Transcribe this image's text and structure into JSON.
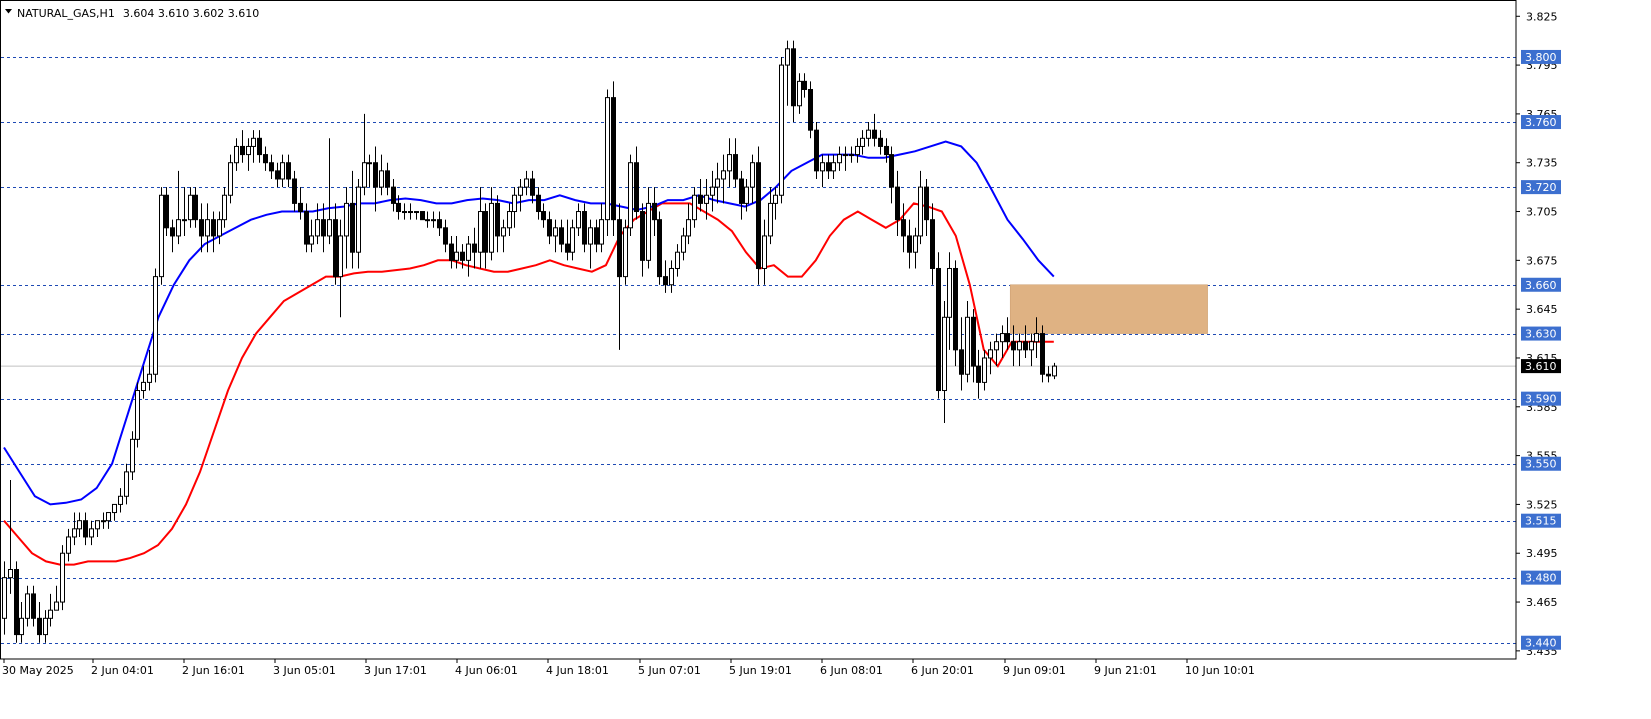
{
  "header": {
    "symbol": "NATURAL_GAS,H1",
    "ohlc": "3.604 3.610 3.602 3.610"
  },
  "colors": {
    "background": "#ffffff",
    "frame": "#000000",
    "level_line": "#1e4ab4",
    "level_tag": "#3c6fcf",
    "ema_fast": "#ff0000",
    "ema_slow": "#0000ff",
    "zone_fill": "#dfb283",
    "current_price_tag": "#000000",
    "bull_candle_body": "#ffffff",
    "bear_candle_body": "#000000"
  },
  "chart_data": {
    "type": "candlestick",
    "instrument": "NATURAL_GAS",
    "timeframe": "H1",
    "ylim": [
      3.43,
      3.835
    ],
    "y_ticks": [
      "3.825",
      "3.795",
      "3.765",
      "3.735",
      "3.705",
      "3.675",
      "3.645",
      "3.615",
      "3.585",
      "3.555",
      "3.525",
      "3.495",
      "3.465",
      "3.435"
    ],
    "x_ticks": [
      "30 May 2025",
      "2 Jun 04:01",
      "2 Jun 16:01",
      "3 Jun 05:01",
      "3 Jun 17:01",
      "4 Jun 06:01",
      "4 Jun 18:01",
      "5 Jun 07:01",
      "5 Jun 19:01",
      "6 Jun 08:01",
      "6 Jun 20:01",
      "9 Jun 09:01",
      "9 Jun 21:01",
      "10 Jun 10:01"
    ],
    "levels": [
      3.8,
      3.76,
      3.72,
      3.66,
      3.63,
      3.59,
      3.55,
      3.515,
      3.48,
      3.44
    ],
    "level_labels": [
      "3.800",
      "3.760",
      "3.720",
      "3.660",
      "3.630",
      "3.590",
      "3.550",
      "3.515",
      "3.480",
      "3.440"
    ],
    "current_price": 3.61,
    "current_price_label": "3.610",
    "zone": {
      "top": 3.66,
      "bottom": 3.63,
      "from_bar": 174,
      "to_bar": 207
    },
    "candles": [
      [
        3.455,
        3.49,
        3.445,
        3.48
      ],
      [
        3.48,
        3.54,
        3.47,
        3.485
      ],
      [
        3.485,
        3.49,
        3.44,
        3.445
      ],
      [
        3.445,
        3.465,
        3.44,
        3.455
      ],
      [
        3.455,
        3.475,
        3.45,
        3.47
      ],
      [
        3.47,
        3.475,
        3.45,
        3.455
      ],
      [
        3.455,
        3.465,
        3.44,
        3.445
      ],
      [
        3.445,
        3.46,
        3.44,
        3.455
      ],
      [
        3.455,
        3.47,
        3.45,
        3.46
      ],
      [
        3.46,
        3.475,
        3.46,
        3.465
      ],
      [
        3.465,
        3.5,
        3.46,
        3.495
      ],
      [
        3.495,
        3.51,
        3.49,
        3.505
      ],
      [
        3.505,
        3.52,
        3.5,
        3.51
      ],
      [
        3.51,
        3.52,
        3.505,
        3.515
      ],
      [
        3.515,
        3.52,
        3.5,
        3.505
      ],
      [
        3.505,
        3.515,
        3.5,
        3.51
      ],
      [
        3.51,
        3.515,
        3.505,
        3.515
      ],
      [
        3.515,
        3.52,
        3.51,
        3.515
      ],
      [
        3.515,
        3.52,
        3.51,
        3.52
      ],
      [
        3.52,
        3.525,
        3.515,
        3.525
      ],
      [
        3.525,
        3.535,
        3.52,
        3.53
      ],
      [
        3.53,
        3.55,
        3.525,
        3.545
      ],
      [
        3.545,
        3.57,
        3.54,
        3.565
      ],
      [
        3.565,
        3.6,
        3.56,
        3.595
      ],
      [
        3.595,
        3.61,
        3.59,
        3.6
      ],
      [
        3.6,
        3.62,
        3.595,
        3.605
      ],
      [
        3.605,
        3.67,
        3.6,
        3.665
      ],
      [
        3.665,
        3.72,
        3.66,
        3.715
      ],
      [
        3.715,
        3.72,
        3.69,
        3.695
      ],
      [
        3.695,
        3.7,
        3.68,
        3.69
      ],
      [
        3.69,
        3.73,
        3.685,
        3.7
      ],
      [
        3.7,
        3.72,
        3.69,
        3.7
      ],
      [
        3.7,
        3.72,
        3.695,
        3.715
      ],
      [
        3.715,
        3.72,
        3.695,
        3.7
      ],
      [
        3.7,
        3.71,
        3.68,
        3.69
      ],
      [
        3.69,
        3.71,
        3.68,
        3.7
      ],
      [
        3.7,
        3.705,
        3.68,
        3.69
      ],
      [
        3.69,
        3.705,
        3.685,
        3.7
      ],
      [
        3.7,
        3.72,
        3.695,
        3.715
      ],
      [
        3.715,
        3.74,
        3.71,
        3.735
      ],
      [
        3.735,
        3.75,
        3.73,
        3.745
      ],
      [
        3.745,
        3.755,
        3.735,
        3.74
      ],
      [
        3.74,
        3.75,
        3.73,
        3.745
      ],
      [
        3.745,
        3.755,
        3.735,
        3.75
      ],
      [
        3.75,
        3.755,
        3.735,
        3.74
      ],
      [
        3.74,
        3.745,
        3.73,
        3.735
      ],
      [
        3.735,
        3.74,
        3.725,
        3.73
      ],
      [
        3.73,
        3.735,
        3.72,
        3.725
      ],
      [
        3.725,
        3.74,
        3.72,
        3.735
      ],
      [
        3.735,
        3.74,
        3.72,
        3.725
      ],
      [
        3.725,
        3.73,
        3.705,
        3.71
      ],
      [
        3.71,
        3.72,
        3.7,
        3.705
      ],
      [
        3.705,
        3.71,
        3.68,
        3.685
      ],
      [
        3.685,
        3.7,
        3.68,
        3.69
      ],
      [
        3.69,
        3.71,
        3.685,
        3.7
      ],
      [
        3.7,
        3.71,
        3.68,
        3.69
      ],
      [
        3.69,
        3.75,
        3.685,
        3.7
      ],
      [
        3.7,
        3.71,
        3.66,
        3.665
      ],
      [
        3.665,
        3.7,
        3.64,
        3.69
      ],
      [
        3.69,
        3.72,
        3.67,
        3.71
      ],
      [
        3.71,
        3.73,
        3.67,
        3.68
      ],
      [
        3.68,
        3.725,
        3.67,
        3.72
      ],
      [
        3.72,
        3.765,
        3.715,
        3.735
      ],
      [
        3.735,
        3.74,
        3.72,
        3.735
      ],
      [
        3.735,
        3.745,
        3.705,
        3.72
      ],
      [
        3.72,
        3.74,
        3.715,
        3.73
      ],
      [
        3.73,
        3.735,
        3.715,
        3.72
      ],
      [
        3.72,
        3.725,
        3.705,
        3.71
      ],
      [
        3.71,
        3.715,
        3.7,
        3.705
      ],
      [
        3.705,
        3.71,
        3.7,
        3.705
      ],
      [
        3.705,
        3.71,
        3.7,
        3.705
      ],
      [
        3.705,
        3.705,
        3.7,
        3.705
      ],
      [
        3.705,
        3.705,
        3.7,
        3.7
      ],
      [
        3.7,
        3.705,
        3.695,
        3.7
      ],
      [
        3.7,
        3.705,
        3.695,
        3.7
      ],
      [
        3.7,
        3.705,
        3.69,
        3.695
      ],
      [
        3.695,
        3.7,
        3.68,
        3.685
      ],
      [
        3.685,
        3.69,
        3.67,
        3.675
      ],
      [
        3.675,
        3.69,
        3.67,
        3.68
      ],
      [
        3.68,
        3.685,
        3.67,
        3.675
      ],
      [
        3.675,
        3.69,
        3.665,
        3.685
      ],
      [
        3.685,
        3.695,
        3.67,
        3.68
      ],
      [
        3.68,
        3.72,
        3.67,
        3.705
      ],
      [
        3.705,
        3.71,
        3.67,
        3.68
      ],
      [
        3.68,
        3.72,
        3.675,
        3.71
      ],
      [
        3.71,
        3.715,
        3.68,
        3.69
      ],
      [
        3.69,
        3.7,
        3.68,
        3.695
      ],
      [
        3.695,
        3.71,
        3.69,
        3.705
      ],
      [
        3.705,
        3.72,
        3.695,
        3.715
      ],
      [
        3.715,
        3.725,
        3.705,
        3.72
      ],
      [
        3.72,
        3.73,
        3.715,
        3.725
      ],
      [
        3.725,
        3.73,
        3.71,
        3.715
      ],
      [
        3.715,
        3.72,
        3.7,
        3.705
      ],
      [
        3.705,
        3.71,
        3.695,
        3.7
      ],
      [
        3.7,
        3.705,
        3.685,
        3.69
      ],
      [
        3.69,
        3.7,
        3.68,
        3.695
      ],
      [
        3.695,
        3.7,
        3.68,
        3.685
      ],
      [
        3.685,
        3.7,
        3.675,
        3.68
      ],
      [
        3.68,
        3.7,
        3.675,
        3.695
      ],
      [
        3.695,
        3.71,
        3.69,
        3.705
      ],
      [
        3.705,
        3.71,
        3.68,
        3.685
      ],
      [
        3.685,
        3.7,
        3.67,
        3.695
      ],
      [
        3.695,
        3.7,
        3.68,
        3.685
      ],
      [
        3.685,
        3.71,
        3.68,
        3.7
      ],
      [
        3.7,
        3.78,
        3.69,
        3.775
      ],
      [
        3.775,
        3.785,
        3.69,
        3.7
      ],
      [
        3.7,
        3.71,
        3.62,
        3.665
      ],
      [
        3.665,
        3.7,
        3.66,
        3.695
      ],
      [
        3.695,
        3.74,
        3.69,
        3.735
      ],
      [
        3.735,
        3.745,
        3.7,
        3.705
      ],
      [
        3.705,
        3.71,
        3.665,
        3.675
      ],
      [
        3.675,
        3.72,
        3.67,
        3.71
      ],
      [
        3.71,
        3.72,
        3.69,
        3.7
      ],
      [
        3.7,
        3.705,
        3.66,
        3.665
      ],
      [
        3.665,
        3.675,
        3.655,
        3.66
      ],
      [
        3.66,
        3.675,
        3.655,
        3.67
      ],
      [
        3.67,
        3.685,
        3.665,
        3.68
      ],
      [
        3.68,
        3.695,
        3.675,
        3.69
      ],
      [
        3.69,
        3.71,
        3.685,
        3.7
      ],
      [
        3.7,
        3.72,
        3.695,
        3.715
      ],
      [
        3.715,
        3.725,
        3.705,
        3.71
      ],
      [
        3.71,
        3.725,
        3.7,
        3.715
      ],
      [
        3.715,
        3.73,
        3.705,
        3.72
      ],
      [
        3.72,
        3.735,
        3.71,
        3.725
      ],
      [
        3.725,
        3.74,
        3.71,
        3.73
      ],
      [
        3.73,
        3.75,
        3.72,
        3.74
      ],
      [
        3.74,
        3.75,
        3.72,
        3.725
      ],
      [
        3.725,
        3.73,
        3.7,
        3.71
      ],
      [
        3.71,
        3.725,
        3.705,
        3.72
      ],
      [
        3.72,
        3.74,
        3.71,
        3.735
      ],
      [
        3.735,
        3.745,
        3.66,
        3.67
      ],
      [
        3.67,
        3.7,
        3.66,
        3.69
      ],
      [
        3.69,
        3.72,
        3.685,
        3.71
      ],
      [
        3.71,
        3.72,
        3.7,
        3.715
      ],
      [
        3.715,
        3.8,
        3.71,
        3.795
      ],
      [
        3.795,
        3.81,
        3.77,
        3.805
      ],
      [
        3.805,
        3.81,
        3.76,
        3.77
      ],
      [
        3.77,
        3.79,
        3.765,
        3.785
      ],
      [
        3.785,
        3.79,
        3.775,
        3.78
      ],
      [
        3.78,
        3.785,
        3.75,
        3.755
      ],
      [
        3.755,
        3.76,
        3.725,
        3.73
      ],
      [
        3.73,
        3.74,
        3.72,
        3.735
      ],
      [
        3.735,
        3.74,
        3.725,
        3.73
      ],
      [
        3.73,
        3.74,
        3.725,
        3.735
      ],
      [
        3.735,
        3.745,
        3.73,
        3.74
      ],
      [
        3.74,
        3.745,
        3.73,
        3.74
      ],
      [
        3.74,
        3.745,
        3.735,
        3.74
      ],
      [
        3.74,
        3.75,
        3.735,
        3.745
      ],
      [
        3.745,
        3.755,
        3.74,
        3.75
      ],
      [
        3.75,
        3.76,
        3.745,
        3.755
      ],
      [
        3.755,
        3.765,
        3.745,
        3.75
      ],
      [
        3.75,
        3.755,
        3.74,
        3.745
      ],
      [
        3.745,
        3.75,
        3.735,
        3.74
      ],
      [
        3.74,
        3.745,
        3.71,
        3.72
      ],
      [
        3.72,
        3.73,
        3.69,
        3.7
      ],
      [
        3.7,
        3.71,
        3.68,
        3.69
      ],
      [
        3.69,
        3.7,
        3.67,
        3.68
      ],
      [
        3.68,
        3.695,
        3.67,
        3.69
      ],
      [
        3.69,
        3.73,
        3.685,
        3.72
      ],
      [
        3.72,
        3.725,
        3.69,
        3.7
      ],
      [
        3.7,
        3.71,
        3.66,
        3.67
      ],
      [
        3.67,
        3.68,
        3.59,
        3.595
      ],
      [
        3.595,
        3.65,
        3.575,
        3.64
      ],
      [
        3.64,
        3.68,
        3.62,
        3.67
      ],
      [
        3.67,
        3.675,
        3.61,
        3.62
      ],
      [
        3.62,
        3.64,
        3.595,
        3.605
      ],
      [
        3.605,
        3.65,
        3.6,
        3.64
      ],
      [
        3.64,
        3.645,
        3.6,
        3.61
      ],
      [
        3.61,
        3.62,
        3.59,
        3.6
      ],
      [
        3.6,
        3.62,
        3.595,
        3.615
      ],
      [
        3.615,
        3.625,
        3.605,
        3.62
      ],
      [
        3.62,
        3.63,
        3.61,
        3.625
      ],
      [
        3.625,
        3.635,
        3.615,
        3.63
      ],
      [
        3.63,
        3.64,
        3.62,
        3.625
      ],
      [
        3.625,
        3.635,
        3.61,
        3.62
      ],
      [
        3.62,
        3.63,
        3.61,
        3.625
      ],
      [
        3.625,
        3.635,
        3.615,
        3.62
      ],
      [
        3.62,
        3.63,
        3.61,
        3.625
      ],
      [
        3.625,
        3.64,
        3.615,
        3.63
      ],
      [
        3.63,
        3.635,
        3.6,
        3.605
      ],
      [
        3.605,
        3.61,
        3.6,
        3.604
      ],
      [
        3.604,
        3.612,
        3.602,
        3.61
      ]
    ],
    "ema_fast": [
      3.515,
      3.505,
      3.495,
      3.49,
      3.488,
      3.488,
      3.49,
      3.49,
      3.49,
      3.492,
      3.495,
      3.5,
      3.51,
      3.525,
      3.545,
      3.57,
      3.595,
      3.615,
      3.63,
      3.64,
      3.65,
      3.655,
      3.66,
      3.665,
      3.665,
      3.667,
      3.668,
      3.668,
      3.669,
      3.67,
      3.672,
      3.675,
      3.675,
      3.672,
      3.67,
      3.668,
      3.668,
      3.67,
      3.672,
      3.675,
      3.672,
      3.67,
      3.668,
      3.672,
      3.69,
      3.7,
      3.705,
      3.71,
      3.71,
      3.71,
      3.705,
      3.7,
      3.693,
      3.68,
      3.67,
      3.672,
      3.665,
      3.665,
      3.675,
      3.69,
      3.7,
      3.705,
      3.7,
      3.695,
      3.7,
      3.71,
      3.708,
      3.705,
      3.69,
      3.66,
      3.62,
      3.61,
      3.625,
      3.625,
      3.625,
      3.625
    ],
    "ema_slow": [
      3.56,
      3.545,
      3.53,
      3.525,
      3.526,
      3.528,
      3.535,
      3.55,
      3.58,
      3.61,
      3.64,
      3.66,
      3.675,
      3.685,
      3.69,
      3.695,
      3.7,
      3.703,
      3.705,
      3.705,
      3.705,
      3.707,
      3.708,
      3.71,
      3.71,
      3.712,
      3.713,
      3.712,
      3.71,
      3.71,
      3.712,
      3.713,
      3.712,
      3.71,
      3.712,
      3.712,
      3.715,
      3.712,
      3.71,
      3.71,
      3.708,
      3.706,
      3.708,
      3.712,
      3.712,
      3.715,
      3.712,
      3.71,
      3.708,
      3.712,
      3.72,
      3.73,
      3.735,
      3.74,
      3.74,
      3.74,
      3.738,
      3.738,
      3.74,
      3.742,
      3.745,
      3.748,
      3.745,
      3.735,
      3.718,
      3.7,
      3.688,
      3.675,
      3.665
    ]
  }
}
